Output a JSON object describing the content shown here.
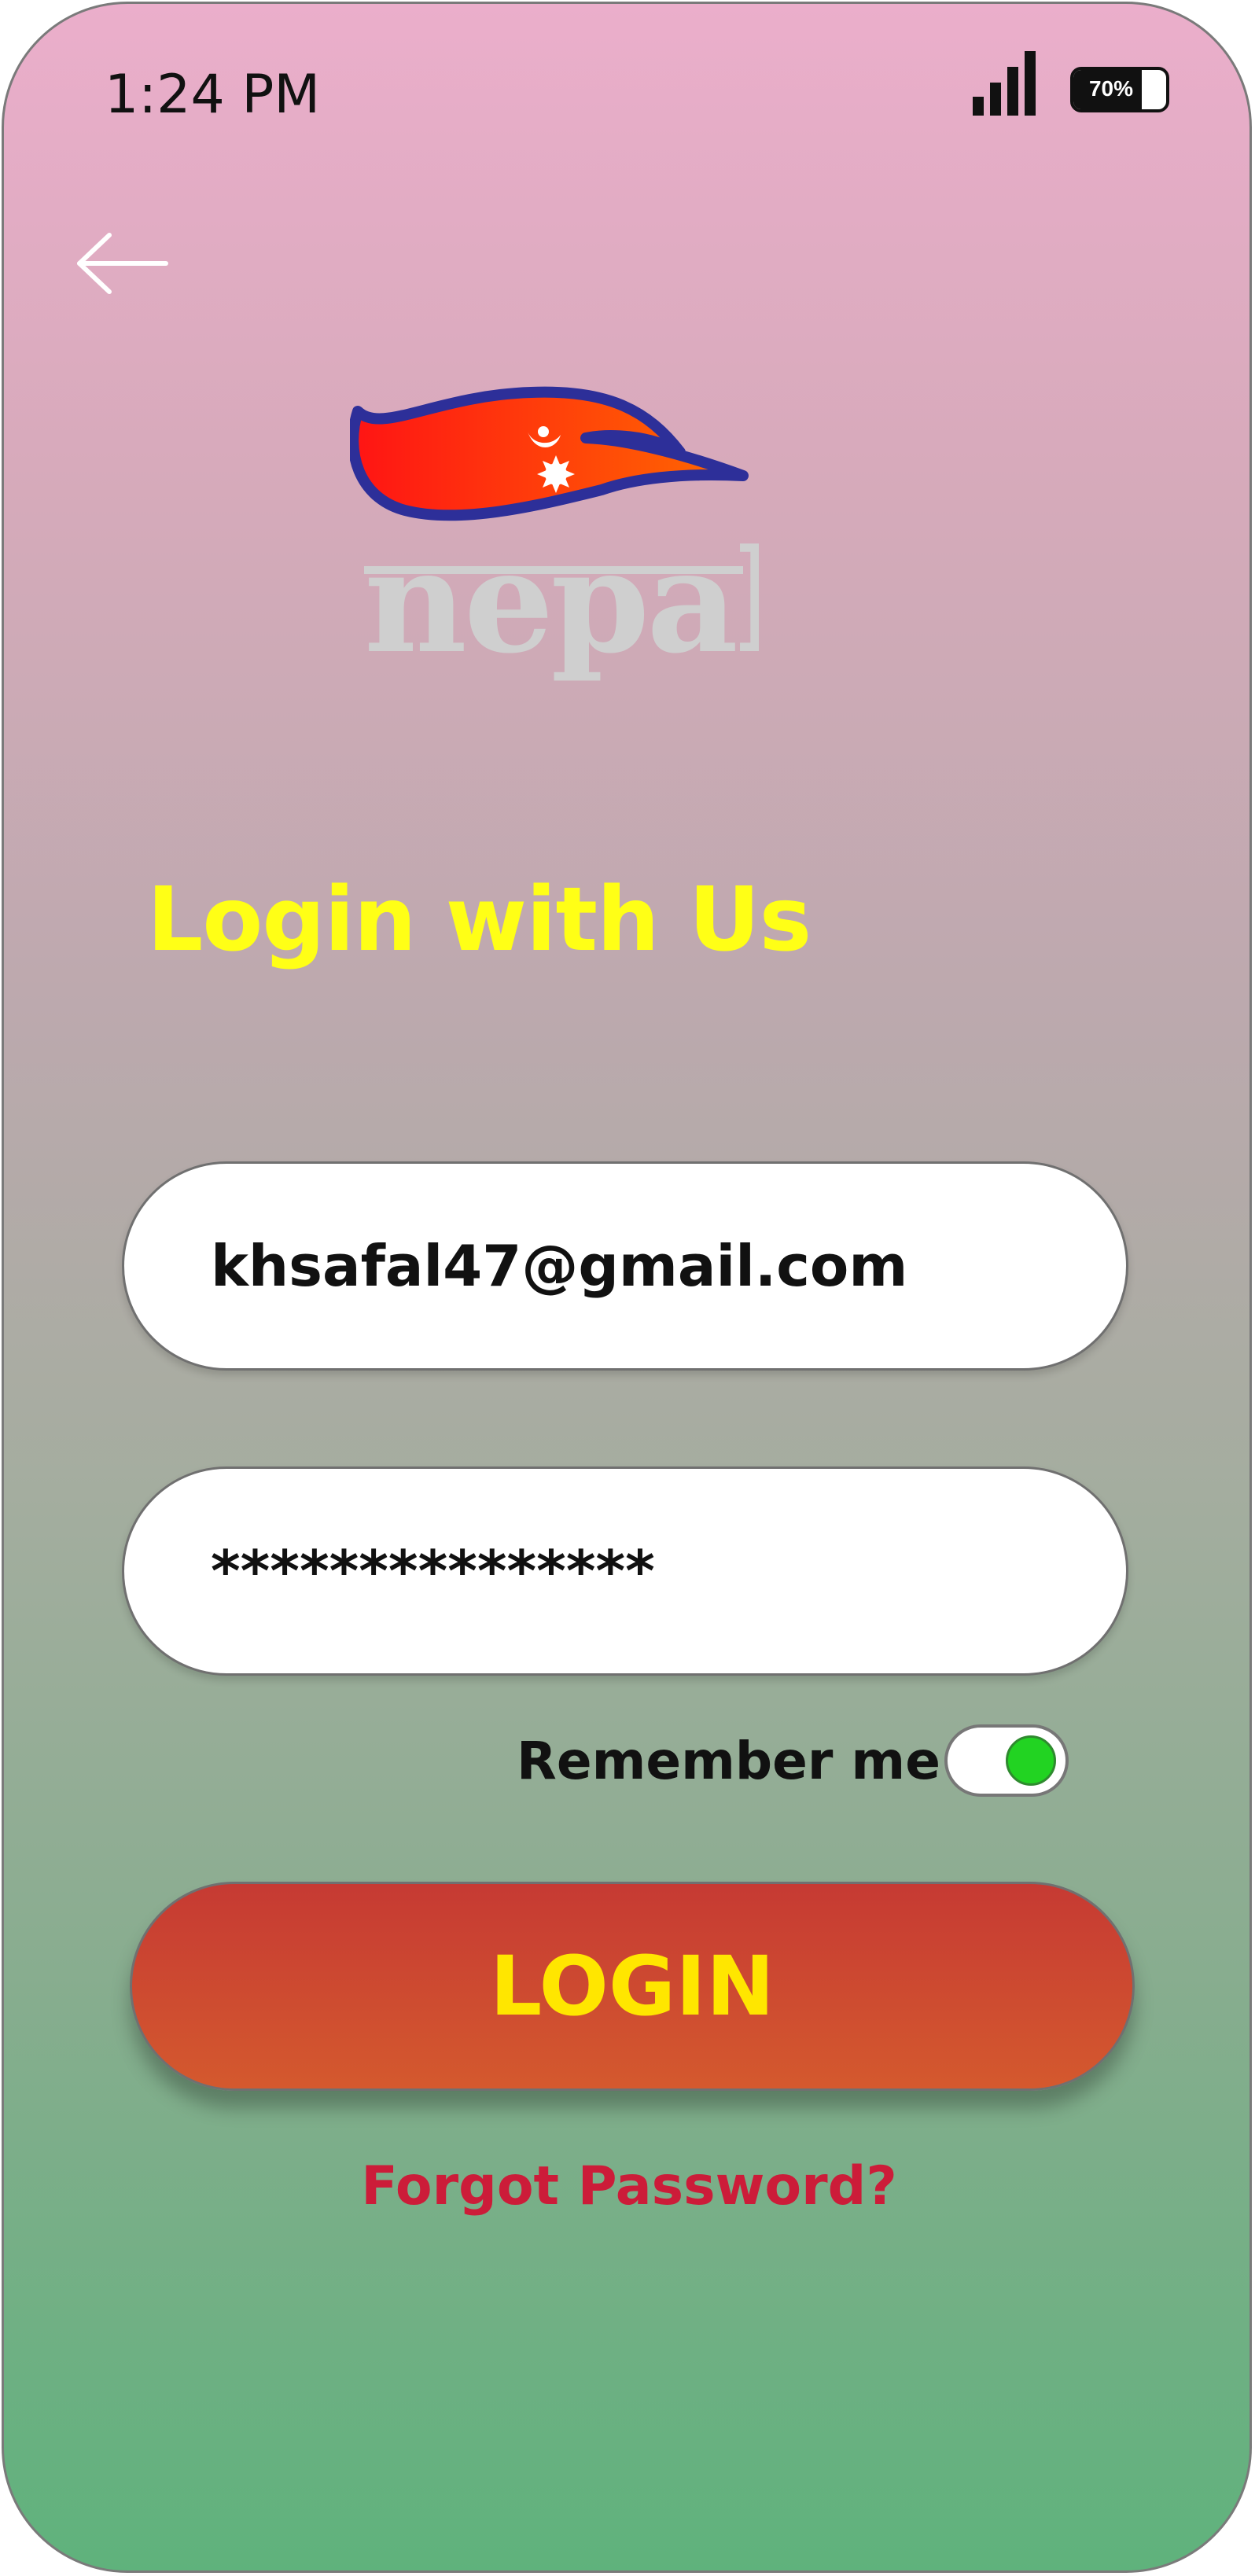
{
  "status_bar": {
    "time": "1:24 PM",
    "battery_level": "70%",
    "battery_fraction": 0.7
  },
  "logo": {
    "text": "nepal",
    "flag_colors": {
      "outline": "#2d2f99",
      "fill_start": "#ff1414",
      "fill_end": "#ff6a00"
    }
  },
  "heading": "Login with Us",
  "form": {
    "email_value": "khsafal47@gmail.com",
    "password_value": "***************",
    "remember_label": "Remember me",
    "remember_checked": true,
    "login_label": "LOGIN",
    "forgot_label": "Forgot Password?"
  },
  "icons": {
    "back": "arrow-left-icon",
    "signal": "signal-icon",
    "battery": "battery-icon"
  },
  "colors": {
    "heading": "#ffff16",
    "login_text": "#ffe600",
    "login_bg": "#c63a33",
    "forgot": "#cc1c39",
    "toggle_on": "#22d322"
  }
}
